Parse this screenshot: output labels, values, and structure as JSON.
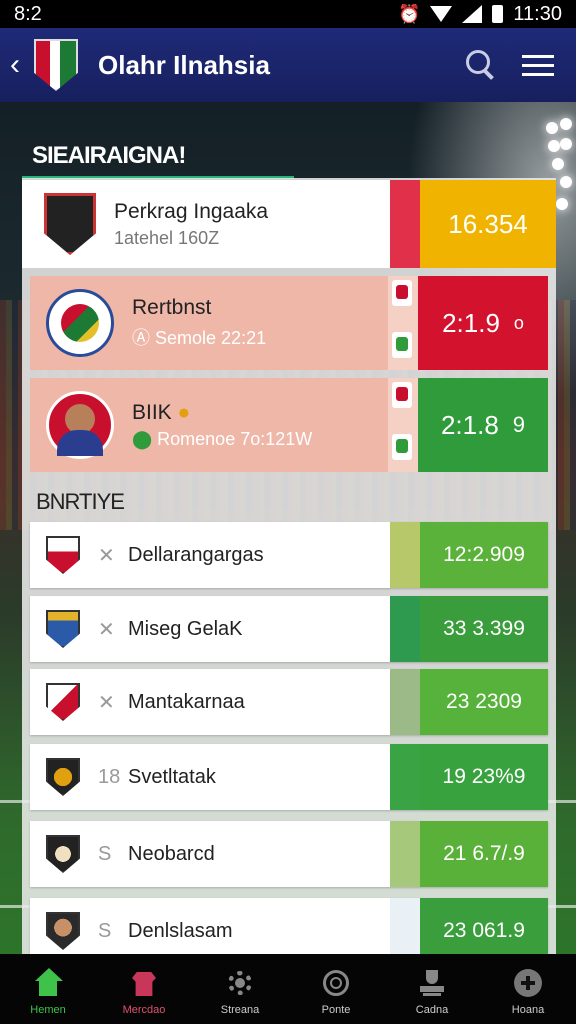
{
  "status_bar": {
    "time": "8:2",
    "clock": "11:30"
  },
  "header": {
    "title": "Olahr Ilnahsia"
  },
  "featured": {
    "heading": "SIEAIRAIGNA!",
    "items": [
      {
        "name": "Perkrag Ingaaka",
        "sub": "1atehel 160Z",
        "score": "16.354",
        "score_color": "#f0b400",
        "strip_color": "#e0304a"
      },
      {
        "name": "Rertbnst",
        "sub": "Semole 22:21",
        "score": "2:1.9",
        "score_suffix": "o",
        "score_color": "#d3132d"
      },
      {
        "name": "BIIK",
        "sub": "Romenoe 7o:121W",
        "score": "2:1.8",
        "score_suffix": "9",
        "score_color": "#2f9b3a"
      }
    ]
  },
  "standings": {
    "heading": "BNRTIYE",
    "rows": [
      {
        "mark": "✕",
        "team": "Dellarangargas",
        "p": "12:2.909",
        "color": "#5bb23a",
        "fade": "#b6c86a"
      },
      {
        "mark": "✕",
        "team": "Miseg GelaK",
        "p": "33  3.399",
        "color": "#3a9d3c",
        "fade": "#2e9a50"
      },
      {
        "mark": "✕",
        "team": "Mantakarnaa",
        "p": "23  2309",
        "color": "#56b23a",
        "fade": "#9cba88"
      },
      {
        "mark": "18",
        "team": "Svetltatak",
        "p": "19  23%9",
        "color": "#38a33e",
        "fade": "#3aa444"
      },
      {
        "mark": "S",
        "team": "Neobarcd",
        "p": "21  6.7/.9",
        "color": "#5ab13a",
        "fade": "#a6c87a"
      },
      {
        "mark": "S",
        "team": "Denlslasam",
        "p": "23  061.9",
        "color": "#3b9e3c",
        "fade": "#e9f0f6"
      }
    ]
  },
  "bottom_nav": [
    {
      "label": "Hemen",
      "icon": "home-icon"
    },
    {
      "label": "Mercdao",
      "icon": "shirt-icon"
    },
    {
      "label": "Streana",
      "icon": "gear-icon"
    },
    {
      "label": "Ponte",
      "icon": "chat-icon"
    },
    {
      "label": "Cadna",
      "icon": "trophy-icon"
    },
    {
      "label": "Hoana",
      "icon": "settings-icon"
    }
  ]
}
